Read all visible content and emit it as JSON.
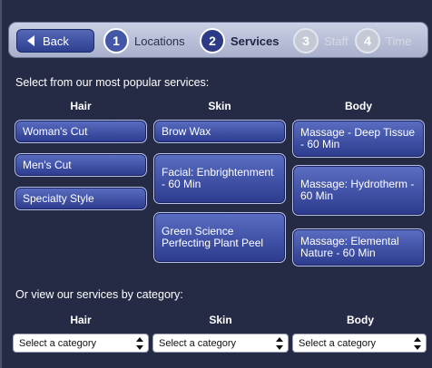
{
  "nav": {
    "back_label": "Back",
    "steps": [
      {
        "num": "1",
        "label": "Locations"
      },
      {
        "num": "2",
        "label": "Services"
      },
      {
        "num": "3",
        "label": "Staff"
      },
      {
        "num": "4",
        "label": "Time"
      }
    ]
  },
  "popular": {
    "intro": "Select from our most popular services:",
    "columns": [
      {
        "heading": "Hair",
        "items": [
          "Woman's Cut",
          "Men's Cut",
          "Specialty Style"
        ]
      },
      {
        "heading": "Skin",
        "items": [
          "Brow Wax",
          "Facial: Enbrightenment - 60 Min",
          "Green Science Perfecting Plant Peel"
        ]
      },
      {
        "heading": "Body",
        "items": [
          "Massage - Deep Tissue - 60 Min",
          "Massage: Hydrotherm - 60 Min",
          "Massage: Elemental Nature - 60 Min"
        ]
      }
    ]
  },
  "category": {
    "label": "Or view our services by category:",
    "columns": [
      {
        "heading": "Hair",
        "select_value": "Select a category"
      },
      {
        "heading": "Skin",
        "select_value": "Select a category"
      },
      {
        "heading": "Body",
        "select_value": "Select a category"
      }
    ]
  }
}
